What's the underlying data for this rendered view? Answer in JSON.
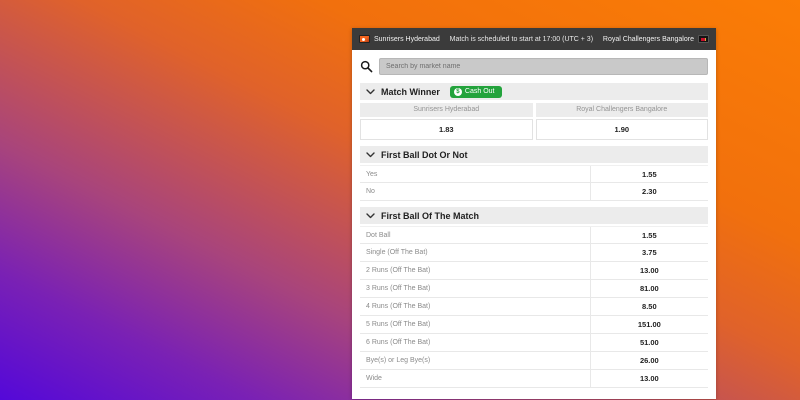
{
  "header": {
    "home_team": "Sunrisers Hyderabad",
    "status_text": "Match is scheduled to start at 17:00 (UTC + 3)",
    "away_team": "Royal Challengers Bangalore"
  },
  "search": {
    "placeholder": "Search by market name"
  },
  "markets": [
    {
      "title": "Match Winner",
      "cash_out_label": "Cash Out",
      "columns": [
        {
          "name": "Sunrisers Hyderabad",
          "odds": "1.83"
        },
        {
          "name": "Royal Challengers Bangalore",
          "odds": "1.90"
        }
      ]
    },
    {
      "title": "First Ball Dot Or Not",
      "rows": [
        {
          "label": "Yes",
          "odds": "1.55"
        },
        {
          "label": "No",
          "odds": "2.30"
        }
      ]
    },
    {
      "title": "First Ball Of The Match",
      "rows": [
        {
          "label": "Dot Ball",
          "odds": "1.55"
        },
        {
          "label": "Single (Off The Bat)",
          "odds": "3.75"
        },
        {
          "label": "2 Runs (Off The Bat)",
          "odds": "13.00"
        },
        {
          "label": "3 Runs (Off The Bat)",
          "odds": "81.00"
        },
        {
          "label": "4 Runs (Off The Bat)",
          "odds": "8.50"
        },
        {
          "label": "5 Runs (Off The Bat)",
          "odds": "151.00"
        },
        {
          "label": "6 Runs (Off The Bat)",
          "odds": "51.00"
        },
        {
          "label": "Bye(s) or Leg Bye(s)",
          "odds": "26.00"
        },
        {
          "label": "Wide",
          "odds": "13.00"
        }
      ]
    }
  ],
  "colors": {
    "header_bar": "#3b3b3b",
    "cash_out_green": "#23a33c",
    "background_gradient_from": "#fb7d05",
    "background_gradient_to": "#5408d9"
  }
}
